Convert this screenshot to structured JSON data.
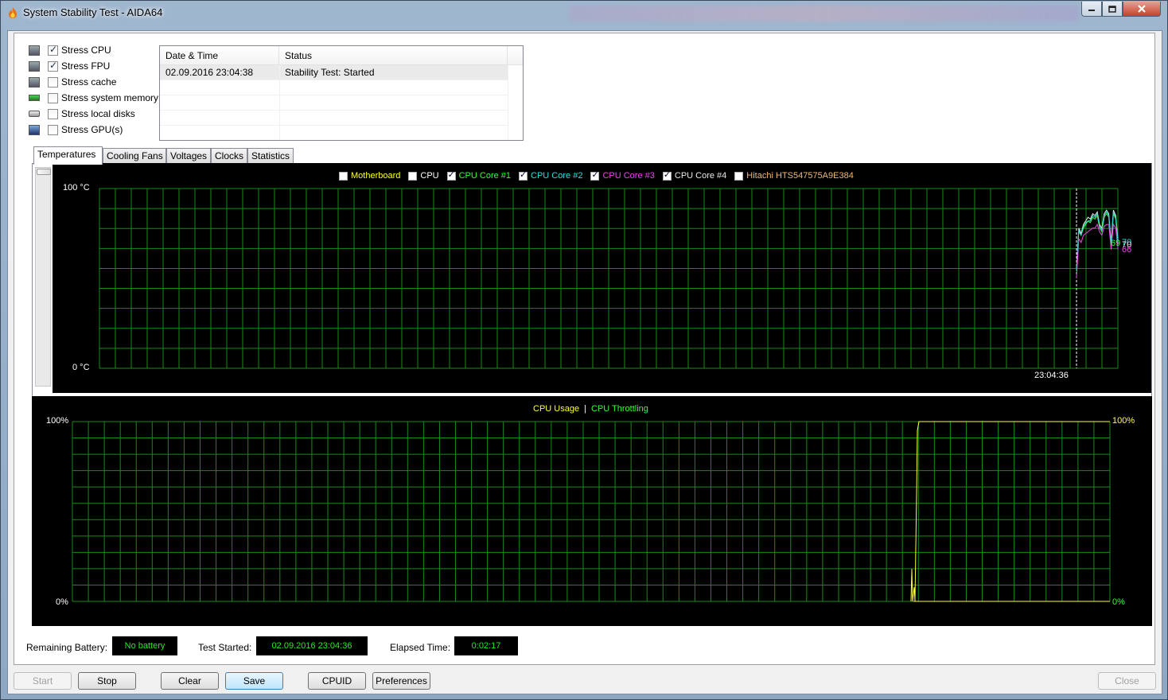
{
  "window": {
    "title": "System Stability Test - AIDA64",
    "caption_buttons": [
      "minimize-icon",
      "maximize-icon",
      "close-icon"
    ]
  },
  "stress_options": [
    {
      "label": "Stress CPU",
      "checked": true,
      "icon": "cpu-icon"
    },
    {
      "label": "Stress FPU",
      "checked": true,
      "icon": "fpu-icon"
    },
    {
      "label": "Stress cache",
      "checked": false,
      "icon": "cache-icon"
    },
    {
      "label": "Stress system memory",
      "checked": false,
      "icon": "memory-icon"
    },
    {
      "label": "Stress local disks",
      "checked": false,
      "icon": "disk-icon"
    },
    {
      "label": "Stress GPU(s)",
      "checked": false,
      "icon": "gpu-icon"
    }
  ],
  "log": {
    "columns": [
      "Date & Time",
      "Status"
    ],
    "rows": [
      [
        "02.09.2016 23:04:38",
        "Stability Test: Started"
      ]
    ]
  },
  "tabs": [
    "Temperatures",
    "Cooling Fans",
    "Voltages",
    "Clocks",
    "Statistics"
  ],
  "active_tab": "Temperatures",
  "temp_graph": {
    "legend": [
      {
        "label": "Motherboard",
        "checked": false,
        "color": "#ffff33"
      },
      {
        "label": "CPU",
        "checked": false,
        "color": "#ffffff"
      },
      {
        "label": "CPU Core #1",
        "checked": true,
        "color": "#33ff33"
      },
      {
        "label": "CPU Core #2",
        "checked": true,
        "color": "#33dddd"
      },
      {
        "label": "CPU Core #3",
        "checked": true,
        "color": "#ee44ee"
      },
      {
        "label": "CPU Core #4",
        "checked": true,
        "color": "#e8e8e8"
      },
      {
        "label": "Hitachi HTS547575A9E384",
        "checked": false,
        "color": "#eebb77"
      }
    ],
    "y_max_label": "100 °C",
    "y_min_label": "0 °C",
    "time_label": "23:04:36",
    "value_labels": [
      "69",
      "70",
      "70",
      "66"
    ],
    "grid_color": "#1a8a1a"
  },
  "cpu_graph": {
    "legend": [
      {
        "label": "CPU Usage",
        "color": "#ffff33"
      },
      {
        "label": "CPU Throttling",
        "color": "#33ff33"
      }
    ],
    "separator": "|",
    "y_max_left": "100%",
    "y_min_left": "0%",
    "y_max_right": "100%",
    "y_min_right": "0%",
    "grid_color": "#1a8a1a"
  },
  "status": {
    "battery_label": "Remaining Battery:",
    "battery_value": "No battery",
    "started_label": "Test Started:",
    "started_value": "02.09.2016 23:04:36",
    "elapsed_label": "Elapsed Time:",
    "elapsed_value": "0:02:17"
  },
  "buttons": {
    "start": "Start",
    "stop": "Stop",
    "clear": "Clear",
    "save": "Save",
    "cpuid": "CPUID",
    "preferences": "Preferences",
    "close": "Close"
  }
}
